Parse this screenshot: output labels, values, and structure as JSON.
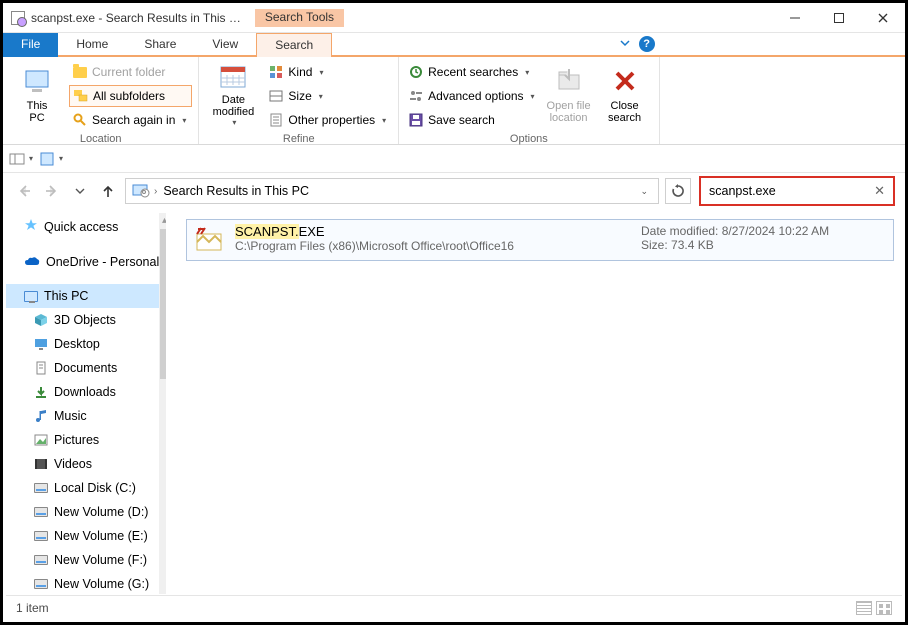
{
  "window": {
    "title": "scanpst.exe - Search Results in This …",
    "contextual_tab_title": "Search Tools",
    "controls": {
      "minimize": "–",
      "maximize": "☐",
      "close": "✕"
    }
  },
  "tabs": {
    "file": "File",
    "home": "Home",
    "share": "Share",
    "view": "View",
    "search": "Search"
  },
  "ribbon": {
    "location": {
      "this_pc": "This\nPC",
      "current_folder": "Current folder",
      "all_subfolders": "All subfolders",
      "search_again": "Search again in",
      "label": "Location"
    },
    "refine": {
      "date_modified": "Date\nmodified",
      "kind": "Kind",
      "size": "Size",
      "other_props": "Other properties",
      "label": "Refine"
    },
    "options": {
      "recent": "Recent searches",
      "advanced": "Advanced options",
      "save_search": "Save search",
      "open_location": "Open file\nlocation",
      "close_search": "Close\nsearch",
      "label": "Options"
    }
  },
  "address": {
    "crumb": "Search Results in This PC"
  },
  "search": {
    "value": "scanpst.exe"
  },
  "nav": {
    "quick_access": "Quick access",
    "onedrive": "OneDrive - Personal",
    "this_pc": "This PC",
    "items": [
      "3D Objects",
      "Desktop",
      "Documents",
      "Downloads",
      "Music",
      "Pictures",
      "Videos",
      "Local Disk (C:)",
      "New Volume (D:)",
      "New Volume (E:)",
      "New Volume (F:)",
      "New Volume (G:)"
    ]
  },
  "result": {
    "name_hl": "SCANPST.",
    "name_rest": "EXE",
    "path": "C:\\Program Files (x86)\\Microsoft Office\\root\\Office16",
    "date_label": "Date modified:",
    "date_value": "8/27/2024 10:22 AM",
    "size_label": "Size:",
    "size_value": "73.4 KB"
  },
  "status": {
    "count": "1 item"
  }
}
